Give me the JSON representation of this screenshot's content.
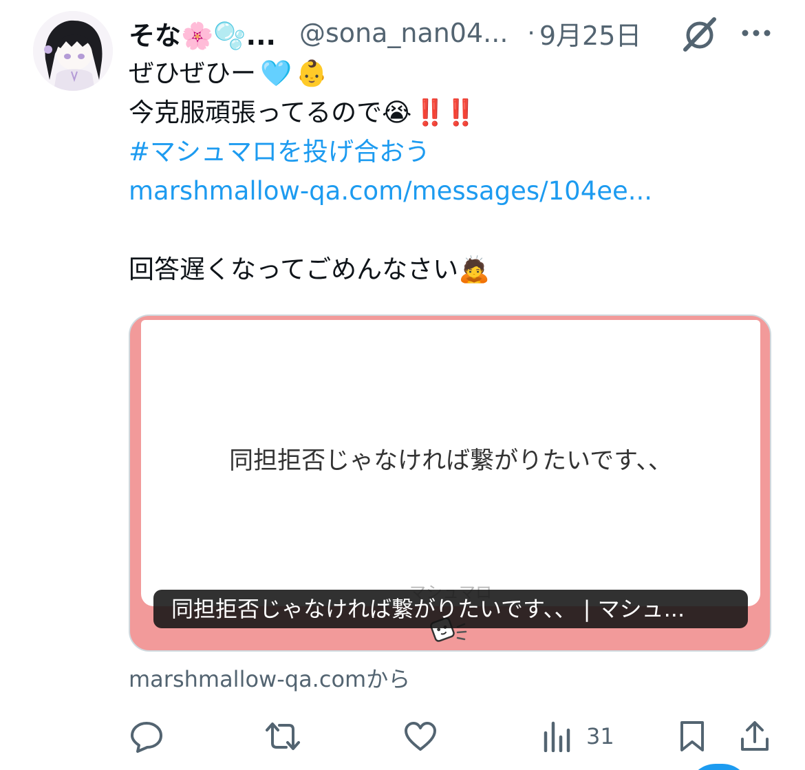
{
  "tweet": {
    "display_name": "そな🌸🫧...",
    "handle": "@sona_nan04...",
    "separator": "·",
    "date": "9月25日",
    "body": {
      "line1_text": "ぜひぜひー",
      "line1_emoji_heart": "🩵",
      "line1_emoji_baby": "👶",
      "line2_text": "今克服頑張ってるので",
      "line2_emoji_cry": "😭",
      "line2_bangs": "‼️‼️",
      "hashtag": "#マシュマロを投げ合おう",
      "link": "marshmallow-qa.com/messages/104ee...",
      "line5_text": "回答遅くなってごめんなさい",
      "line5_emoji_bow": "🙇"
    }
  },
  "card": {
    "message": "同担拒否じゃなければ繋がりたいです、、",
    "brand": "マシュマロ",
    "title": "同担拒否じゃなければ繋がりたいです、、 | マシュ...",
    "source": "marshmallow-qa.comから",
    "background_color": "#f29a9a"
  },
  "actions": {
    "reply_icon": "reply-icon",
    "retweet_icon": "retweet-icon",
    "like_icon": "heart-icon",
    "views_icon": "bar-chart-icon",
    "views_count": "31",
    "bookmark_icon": "bookmark-icon",
    "share_icon": "share-icon"
  },
  "colors": {
    "link": "#1d9bf0",
    "secondary_text": "#536471",
    "primary_text": "#0f1419"
  }
}
